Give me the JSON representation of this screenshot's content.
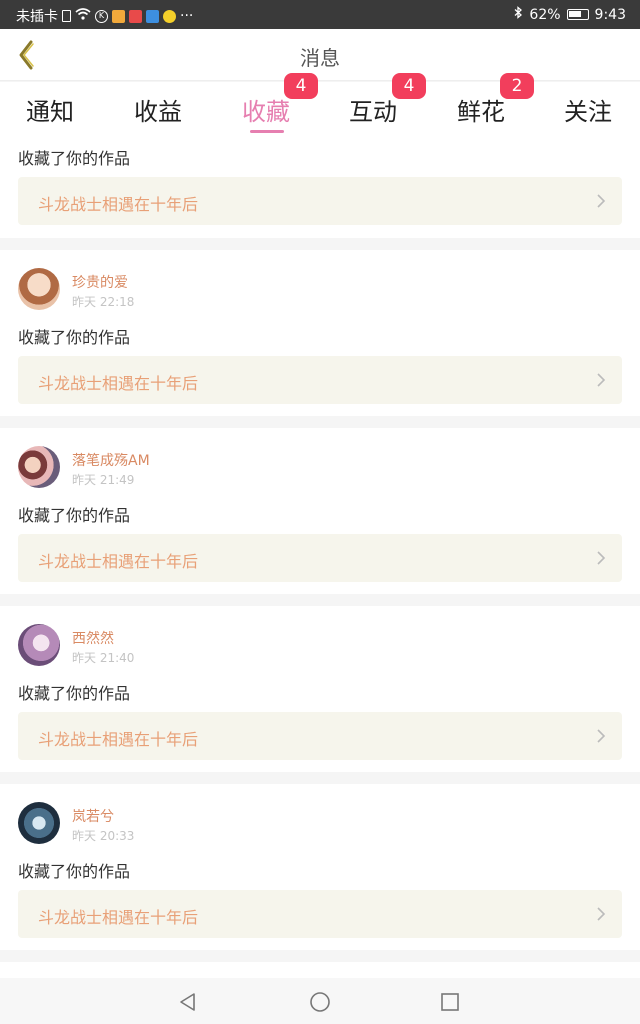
{
  "status_bar": {
    "carrier": "未插卡",
    "more": "···",
    "battery": "62%",
    "time": "9:43"
  },
  "header": {
    "title": "消息",
    "back_icon": "chevron-left-icon"
  },
  "tabs": [
    {
      "label": "通知",
      "badge": ""
    },
    {
      "label": "收益",
      "badge": ""
    },
    {
      "label": "收藏",
      "badge": "4",
      "active": true
    },
    {
      "label": "互动",
      "badge": "4"
    },
    {
      "label": "鲜花",
      "badge": "2"
    },
    {
      "label": "关注",
      "badge": ""
    }
  ],
  "colors": {
    "accent": "#e67fb0",
    "badge": "#f23e5c",
    "username": "#d98a63",
    "work_title": "#e8a077",
    "work_bg": "#f6f5ec"
  },
  "first_item": {
    "action": "收藏了你的作品",
    "work_title": "斗龙战士相遇在十年后"
  },
  "items": [
    {
      "user": "珍贵的爱",
      "time": "昨天 22:18",
      "action": "收藏了你的作品",
      "work_title": "斗龙战士相遇在十年后"
    },
    {
      "user": "落笔成殇AM",
      "time": "昨天 21:49",
      "action": "收藏了你的作品",
      "work_title": "斗龙战士相遇在十年后"
    },
    {
      "user": "西然然",
      "time": "昨天 21:40",
      "action": "收藏了你的作品",
      "work_title": "斗龙战士相遇在十年后"
    },
    {
      "user": "岚若兮",
      "time": "昨天 20:33",
      "action": "收藏了你的作品",
      "work_title": "斗龙战士相遇在十年后"
    }
  ],
  "nav_bar": {
    "back": "triangle-back-icon",
    "home": "circle-home-icon",
    "recents": "square-recents-icon"
  }
}
